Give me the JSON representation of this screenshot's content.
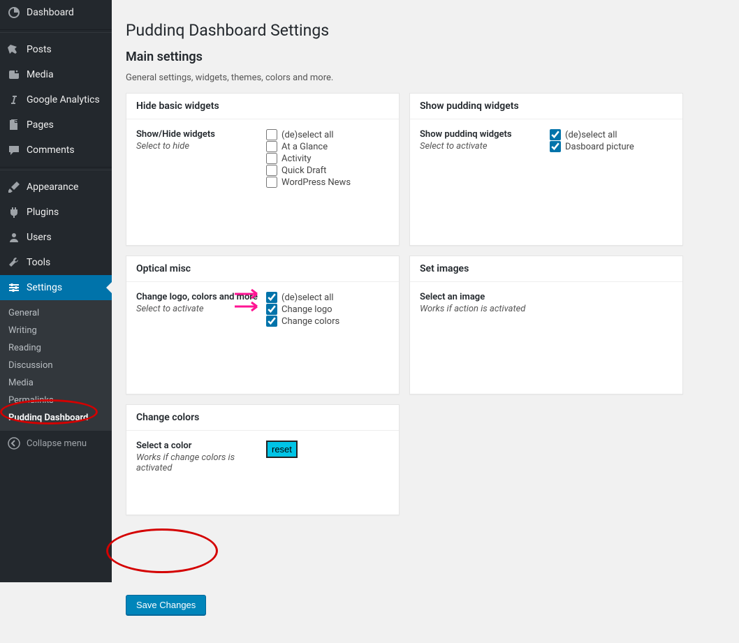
{
  "sidebar": {
    "items": [
      {
        "label": "Dashboard",
        "icon": "dashboard"
      },
      {
        "label": "Posts",
        "icon": "pin"
      },
      {
        "label": "Media",
        "icon": "media"
      },
      {
        "label": "Google Analytics",
        "icon": "italic"
      },
      {
        "label": "Pages",
        "icon": "pages"
      },
      {
        "label": "Comments",
        "icon": "comments"
      },
      {
        "label": "Appearance",
        "icon": "brush"
      },
      {
        "label": "Plugins",
        "icon": "plug"
      },
      {
        "label": "Users",
        "icon": "users"
      },
      {
        "label": "Tools",
        "icon": "tools"
      },
      {
        "label": "Settings",
        "icon": "settings"
      }
    ],
    "submenu": [
      {
        "label": "General"
      },
      {
        "label": "Writing"
      },
      {
        "label": "Reading"
      },
      {
        "label": "Discussion"
      },
      {
        "label": "Media"
      },
      {
        "label": "Permalinks"
      },
      {
        "label": "Puddinq Dashboard",
        "active": true
      }
    ],
    "collapse": "Collapse menu"
  },
  "page": {
    "title": "Puddinq Dashboard Settings",
    "subtitle": "Main settings",
    "description": "General settings, widgets, themes, colors and more."
  },
  "boxes": {
    "hide_basic": {
      "header": "Hide basic widgets",
      "label": "Show/Hide widgets",
      "hint": "Select to hide",
      "options": [
        {
          "label": "(de)select all",
          "checked": false
        },
        {
          "label": "At a Glance",
          "checked": false
        },
        {
          "label": "Activity",
          "checked": false
        },
        {
          "label": "Quick Draft",
          "checked": false
        },
        {
          "label": "WordPress News",
          "checked": false
        }
      ]
    },
    "show_puddinq": {
      "header": "Show puddinq widgets",
      "label": "Show puddinq widgets",
      "hint": "Select to activate",
      "options": [
        {
          "label": "(de)select all",
          "checked": true
        },
        {
          "label": "Dasboard picture",
          "checked": true
        }
      ]
    },
    "optical": {
      "header": "Optical misc",
      "label": "Change logo, colors and more",
      "hint": "Select to activate",
      "options": [
        {
          "label": "(de)select all",
          "checked": true
        },
        {
          "label": "Change logo",
          "checked": true
        },
        {
          "label": "Change colors",
          "checked": true
        }
      ]
    },
    "set_images": {
      "header": "Set images",
      "label": "Select an image",
      "hint": "Works if action is activated"
    },
    "change_colors": {
      "header": "Change colors",
      "label": "Select a color",
      "hint": "Works if change colors is activated",
      "reset": "reset"
    }
  },
  "save": "Save Changes"
}
